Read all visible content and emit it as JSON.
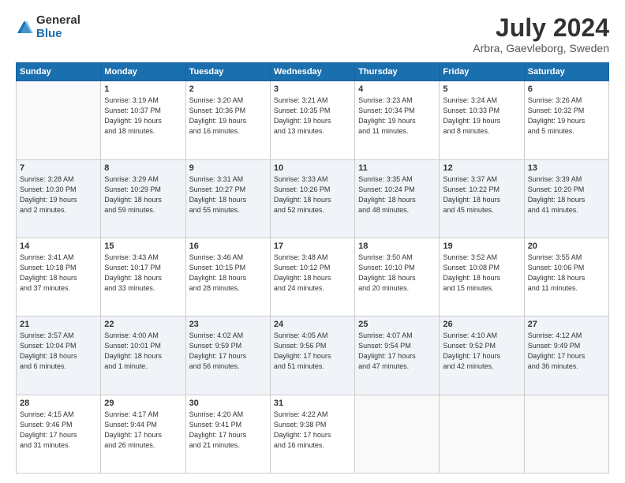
{
  "header": {
    "logo": {
      "general": "General",
      "blue": "Blue"
    },
    "title": "July 2024",
    "location": "Arbra, Gaevleborg, Sweden"
  },
  "calendar": {
    "days_of_week": [
      "Sunday",
      "Monday",
      "Tuesday",
      "Wednesday",
      "Thursday",
      "Friday",
      "Saturday"
    ],
    "weeks": [
      [
        {
          "day": "",
          "info": ""
        },
        {
          "day": "1",
          "info": "Sunrise: 3:19 AM\nSunset: 10:37 PM\nDaylight: 19 hours\nand 18 minutes."
        },
        {
          "day": "2",
          "info": "Sunrise: 3:20 AM\nSunset: 10:36 PM\nDaylight: 19 hours\nand 16 minutes."
        },
        {
          "day": "3",
          "info": "Sunrise: 3:21 AM\nSunset: 10:35 PM\nDaylight: 19 hours\nand 13 minutes."
        },
        {
          "day": "4",
          "info": "Sunrise: 3:23 AM\nSunset: 10:34 PM\nDaylight: 19 hours\nand 11 minutes."
        },
        {
          "day": "5",
          "info": "Sunrise: 3:24 AM\nSunset: 10:33 PM\nDaylight: 19 hours\nand 8 minutes."
        },
        {
          "day": "6",
          "info": "Sunrise: 3:26 AM\nSunset: 10:32 PM\nDaylight: 19 hours\nand 5 minutes."
        }
      ],
      [
        {
          "day": "7",
          "info": "Sunrise: 3:28 AM\nSunset: 10:30 PM\nDaylight: 19 hours\nand 2 minutes."
        },
        {
          "day": "8",
          "info": "Sunrise: 3:29 AM\nSunset: 10:29 PM\nDaylight: 18 hours\nand 59 minutes."
        },
        {
          "day": "9",
          "info": "Sunrise: 3:31 AM\nSunset: 10:27 PM\nDaylight: 18 hours\nand 55 minutes."
        },
        {
          "day": "10",
          "info": "Sunrise: 3:33 AM\nSunset: 10:26 PM\nDaylight: 18 hours\nand 52 minutes."
        },
        {
          "day": "11",
          "info": "Sunrise: 3:35 AM\nSunset: 10:24 PM\nDaylight: 18 hours\nand 48 minutes."
        },
        {
          "day": "12",
          "info": "Sunrise: 3:37 AM\nSunset: 10:22 PM\nDaylight: 18 hours\nand 45 minutes."
        },
        {
          "day": "13",
          "info": "Sunrise: 3:39 AM\nSunset: 10:20 PM\nDaylight: 18 hours\nand 41 minutes."
        }
      ],
      [
        {
          "day": "14",
          "info": "Sunrise: 3:41 AM\nSunset: 10:18 PM\nDaylight: 18 hours\nand 37 minutes."
        },
        {
          "day": "15",
          "info": "Sunrise: 3:43 AM\nSunset: 10:17 PM\nDaylight: 18 hours\nand 33 minutes."
        },
        {
          "day": "16",
          "info": "Sunrise: 3:46 AM\nSunset: 10:15 PM\nDaylight: 18 hours\nand 28 minutes."
        },
        {
          "day": "17",
          "info": "Sunrise: 3:48 AM\nSunset: 10:12 PM\nDaylight: 18 hours\nand 24 minutes."
        },
        {
          "day": "18",
          "info": "Sunrise: 3:50 AM\nSunset: 10:10 PM\nDaylight: 18 hours\nand 20 minutes."
        },
        {
          "day": "19",
          "info": "Sunrise: 3:52 AM\nSunset: 10:08 PM\nDaylight: 18 hours\nand 15 minutes."
        },
        {
          "day": "20",
          "info": "Sunrise: 3:55 AM\nSunset: 10:06 PM\nDaylight: 18 hours\nand 11 minutes."
        }
      ],
      [
        {
          "day": "21",
          "info": "Sunrise: 3:57 AM\nSunset: 10:04 PM\nDaylight: 18 hours\nand 6 minutes."
        },
        {
          "day": "22",
          "info": "Sunrise: 4:00 AM\nSunset: 10:01 PM\nDaylight: 18 hours\nand 1 minute."
        },
        {
          "day": "23",
          "info": "Sunrise: 4:02 AM\nSunset: 9:59 PM\nDaylight: 17 hours\nand 56 minutes."
        },
        {
          "day": "24",
          "info": "Sunrise: 4:05 AM\nSunset: 9:56 PM\nDaylight: 17 hours\nand 51 minutes."
        },
        {
          "day": "25",
          "info": "Sunrise: 4:07 AM\nSunset: 9:54 PM\nDaylight: 17 hours\nand 47 minutes."
        },
        {
          "day": "26",
          "info": "Sunrise: 4:10 AM\nSunset: 9:52 PM\nDaylight: 17 hours\nand 42 minutes."
        },
        {
          "day": "27",
          "info": "Sunrise: 4:12 AM\nSunset: 9:49 PM\nDaylight: 17 hours\nand 36 minutes."
        }
      ],
      [
        {
          "day": "28",
          "info": "Sunrise: 4:15 AM\nSunset: 9:46 PM\nDaylight: 17 hours\nand 31 minutes."
        },
        {
          "day": "29",
          "info": "Sunrise: 4:17 AM\nSunset: 9:44 PM\nDaylight: 17 hours\nand 26 minutes."
        },
        {
          "day": "30",
          "info": "Sunrise: 4:20 AM\nSunset: 9:41 PM\nDaylight: 17 hours\nand 21 minutes."
        },
        {
          "day": "31",
          "info": "Sunrise: 4:22 AM\nSunset: 9:38 PM\nDaylight: 17 hours\nand 16 minutes."
        },
        {
          "day": "",
          "info": ""
        },
        {
          "day": "",
          "info": ""
        },
        {
          "day": "",
          "info": ""
        }
      ]
    ]
  }
}
